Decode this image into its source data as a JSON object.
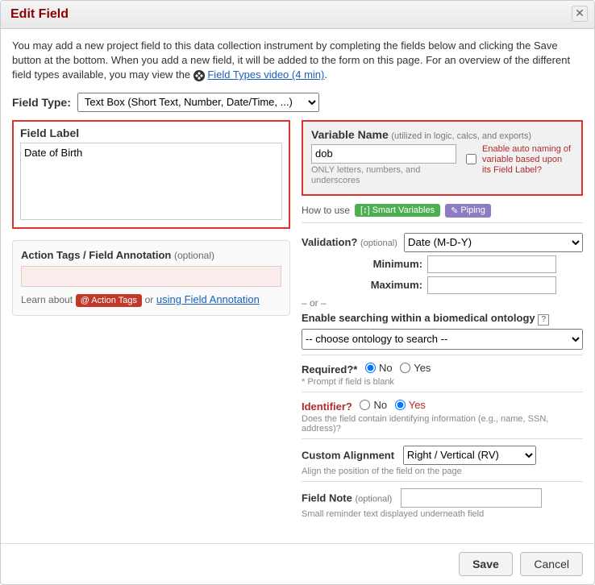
{
  "dialog": {
    "title": "Edit Field",
    "intro_part1": "You may add a new project field to this data collection instrument by completing the fields below and clicking the Save button at the bottom. When you add a new field, it will be added to the form on this page. For an overview of the different field types available, you may view the ",
    "video_link": "Field Types video (4 min)",
    "intro_part3": "."
  },
  "field_type": {
    "label": "Field Type:",
    "value": "Text Box (Short Text, Number, Date/Time, ...)"
  },
  "field_label": {
    "title": "Field Label",
    "value": "Date of Birth"
  },
  "action_tags": {
    "title": "Action Tags / Field Annotation",
    "optional": "(optional)",
    "value": "",
    "learn": "Learn about",
    "btn": "@ Action Tags",
    "or": "or",
    "link": "using Field Annotation"
  },
  "var_name": {
    "title": "Variable Name",
    "hint": "(utilized in logic, calcs, and exports)",
    "value": "dob",
    "sub": "ONLY letters, numbers, and underscores",
    "enable_auto": "Enable auto naming of variable based upon its Field Label?"
  },
  "howto": {
    "label": "How to use",
    "smart": "Smart Variables",
    "piping": "Piping"
  },
  "validation": {
    "title": "Validation?",
    "optional": "(optional)",
    "value": "Date (M-D-Y)",
    "min_label": "Minimum:",
    "max_label": "Maximum:",
    "min": "",
    "max": "",
    "or": "– or –",
    "ontology_title": "Enable searching within a biomedical ontology",
    "ontology_value": "-- choose ontology to search --"
  },
  "required": {
    "title": "Required?*",
    "no": "No",
    "yes": "Yes",
    "sub": "* Prompt if field is blank"
  },
  "identifier": {
    "title": "Identifier?",
    "no": "No",
    "yes": "Yes",
    "sub": "Does the field contain identifying information (e.g., name, SSN, address)?"
  },
  "alignment": {
    "title": "Custom Alignment",
    "value": "Right / Vertical (RV)",
    "sub": "Align the position of the field on the page"
  },
  "field_note": {
    "title": "Field Note",
    "optional": "(optional)",
    "value": "",
    "sub": "Small reminder text displayed underneath field"
  },
  "footer": {
    "save": "Save",
    "cancel": "Cancel"
  }
}
